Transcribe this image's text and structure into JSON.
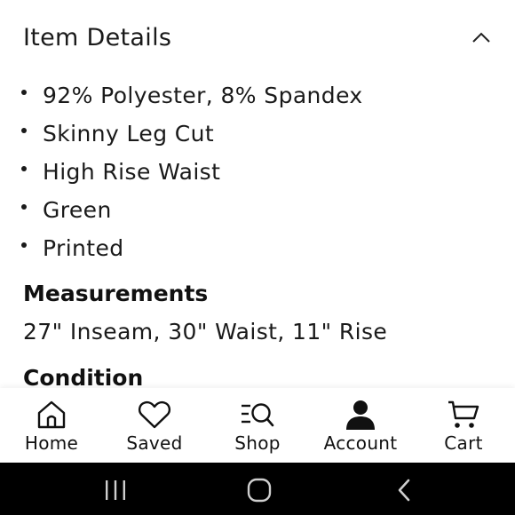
{
  "item_details": {
    "title": "Item Details",
    "collapse_icon": "chevron-up-icon",
    "bullets": [
      "92% Polyester, 8% Spandex",
      "Skinny Leg Cut",
      "High Rise Waist",
      "Green",
      "Printed"
    ]
  },
  "measurements": {
    "heading": "Measurements",
    "text": "27\" Inseam, 30\" Waist, 11\" Rise"
  },
  "condition": {
    "heading": "Condition"
  },
  "bottom_nav": {
    "items": [
      {
        "label": "Home",
        "icon": "home-icon"
      },
      {
        "label": "Saved",
        "icon": "heart-icon"
      },
      {
        "label": "Shop",
        "icon": "shop-search-icon"
      },
      {
        "label": "Account",
        "icon": "person-icon"
      },
      {
        "label": "Cart",
        "icon": "cart-icon"
      }
    ]
  },
  "system_nav": {
    "buttons": [
      "recent-apps-icon",
      "home-circle-icon",
      "back-icon"
    ]
  }
}
